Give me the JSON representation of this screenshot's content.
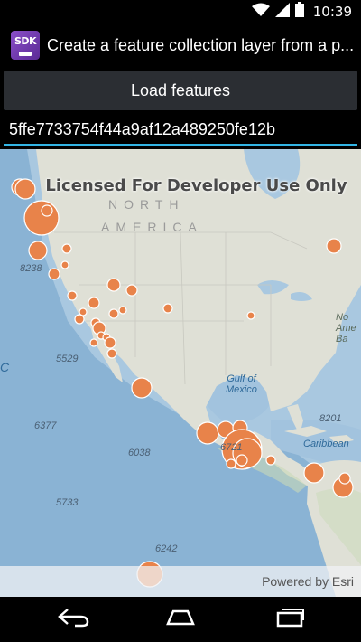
{
  "status_bar": {
    "time": "10:39",
    "icons": [
      "wifi-icon",
      "signal-icon",
      "battery-icon"
    ]
  },
  "action_bar": {
    "icon_text": "SDK",
    "title": "Create a feature collection layer from a p..."
  },
  "controls": {
    "load_button_label": "Load features",
    "portal_item_id": "5ffe7733754f44a9af12a489250fe12b"
  },
  "map": {
    "watermark": "Licensed For Developer Use Only",
    "continent_line1": "NORTH",
    "continent_line2": "AMERICA",
    "gulf_label": "Gulf of\nMexico",
    "caribbean_label": "Caribbean",
    "depth_labels": [
      "8238",
      "5529",
      "6377",
      "6038",
      "5733",
      "6242",
      "6721",
      "8201"
    ],
    "edge_label_left": "C",
    "edge_label_right": "No\nAme\nBa",
    "attribution": "Powered by Esri",
    "feature_color": "#e8834a",
    "water_color": "#8ab3d4",
    "land_color": "#dfe0d6"
  },
  "nav_bar": {
    "buttons": [
      "back-icon",
      "home-icon",
      "recents-icon"
    ]
  }
}
